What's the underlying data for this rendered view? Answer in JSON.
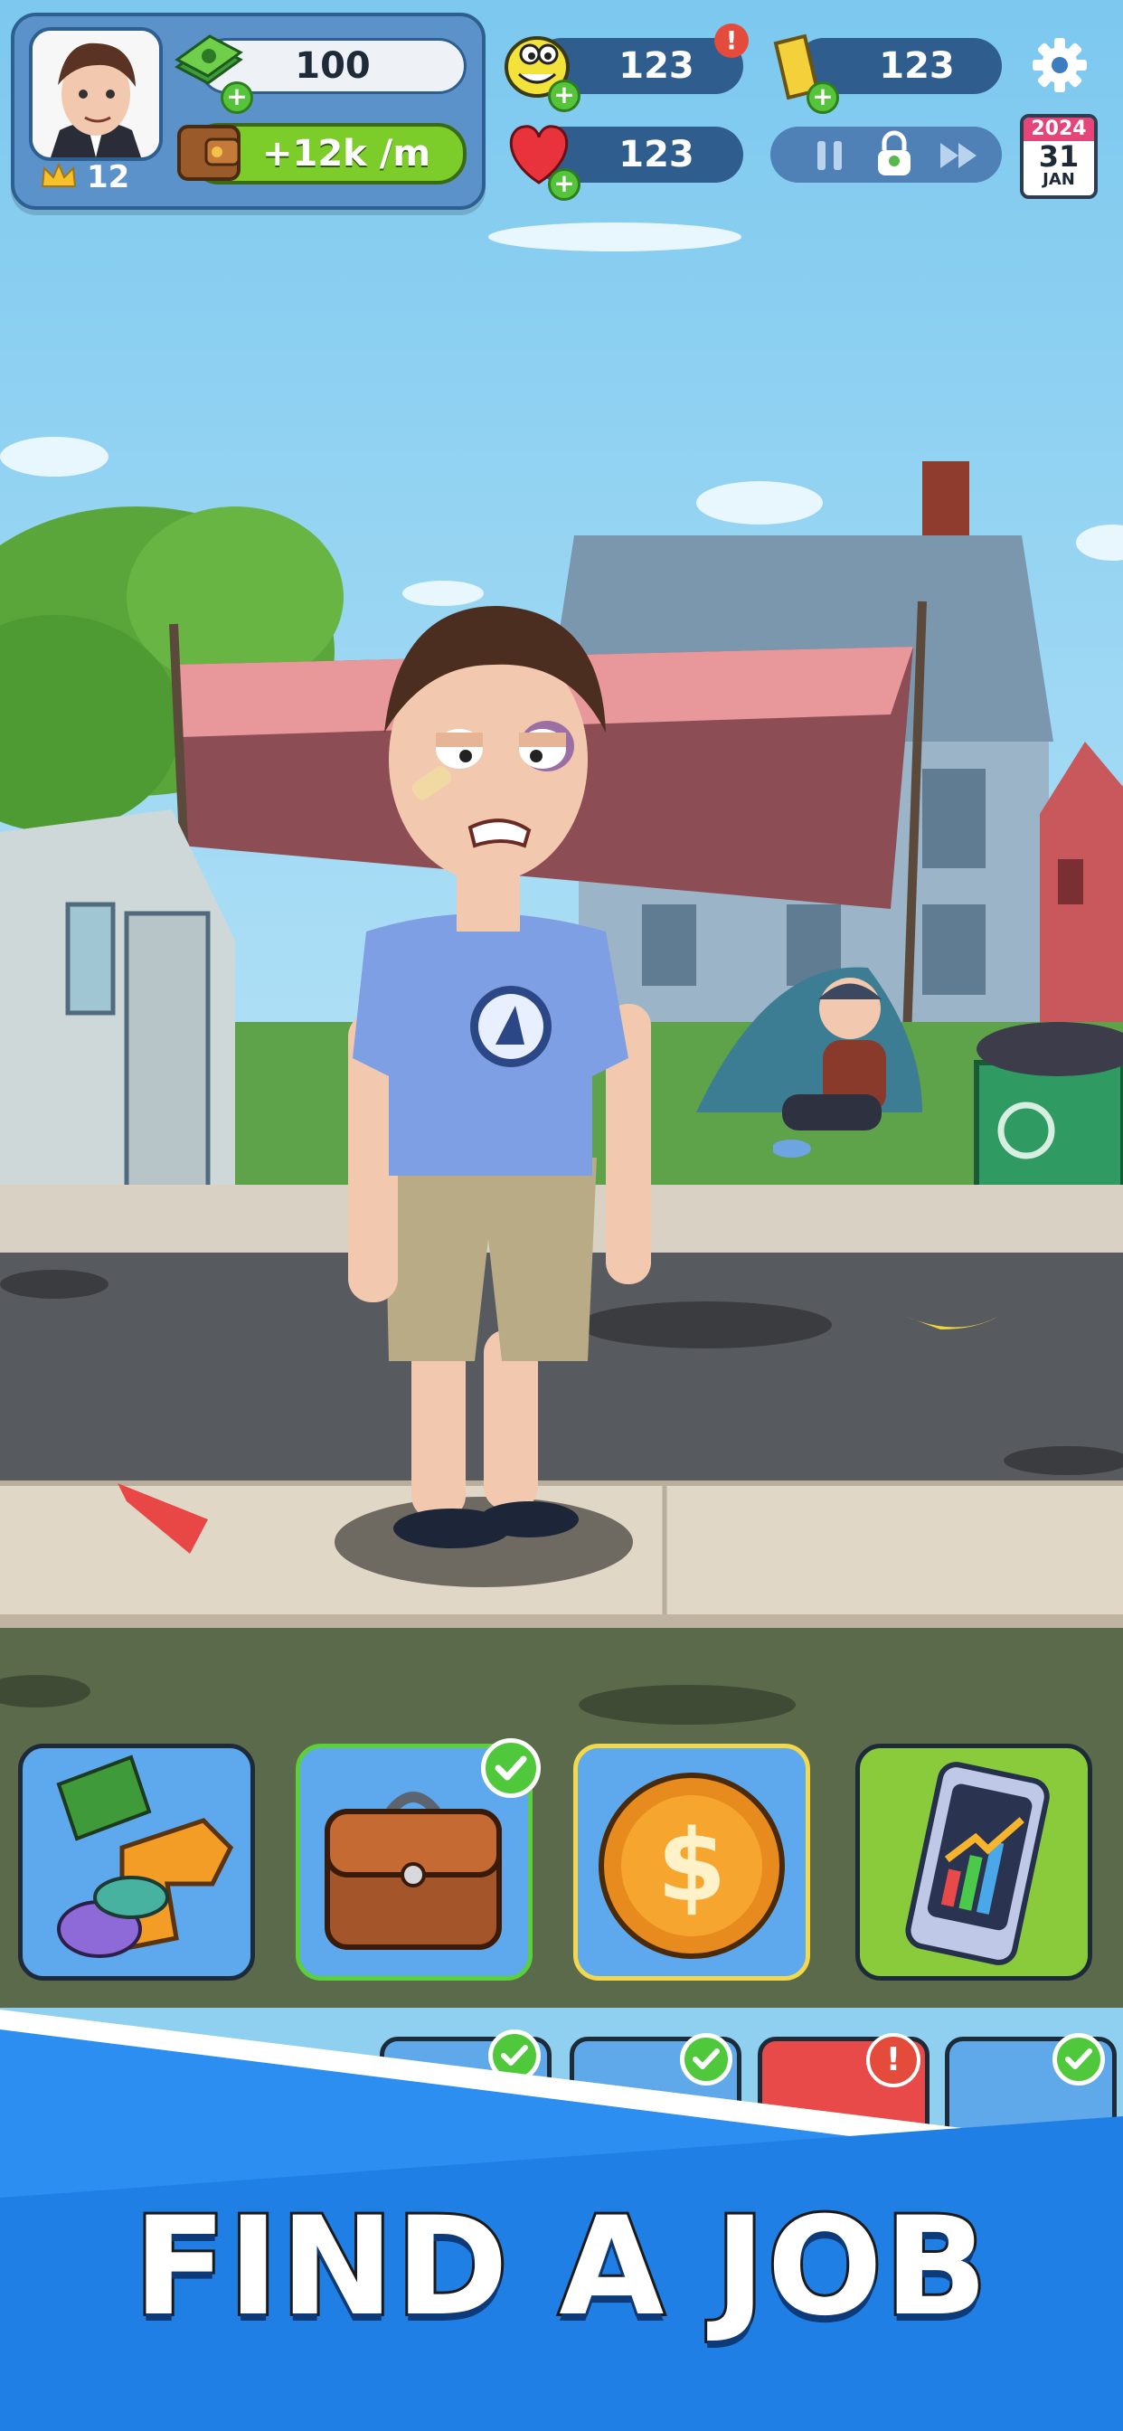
{
  "hud": {
    "level": "12",
    "cash": "100",
    "income": "+12k /m",
    "stat_smiles": "123",
    "stat_tickets": "123",
    "stat_health": "123",
    "date_year": "2024",
    "date_day": "31",
    "date_month": "JAN"
  },
  "banner": {
    "text": "FIND A JOB"
  },
  "colors": {
    "hud_panel": "#5a92c9",
    "stat_pill": "#2f5d8e",
    "income_green": "#7ccd2a",
    "banner_blue": "#1f7fe4",
    "tile_blue": "#5ea8ee",
    "tile_green": "#8acb3c"
  },
  "job_tiles": [
    {
      "name": "gambling-job",
      "icon": "money-gun-chips-icon",
      "checked": false
    },
    {
      "name": "briefcase-job",
      "icon": "briefcase-icon",
      "checked": true
    },
    {
      "name": "coin-job",
      "icon": "dollar-coin-icon",
      "checked": false
    },
    {
      "name": "investing-job",
      "icon": "phone-chart-icon",
      "checked": false
    }
  ]
}
